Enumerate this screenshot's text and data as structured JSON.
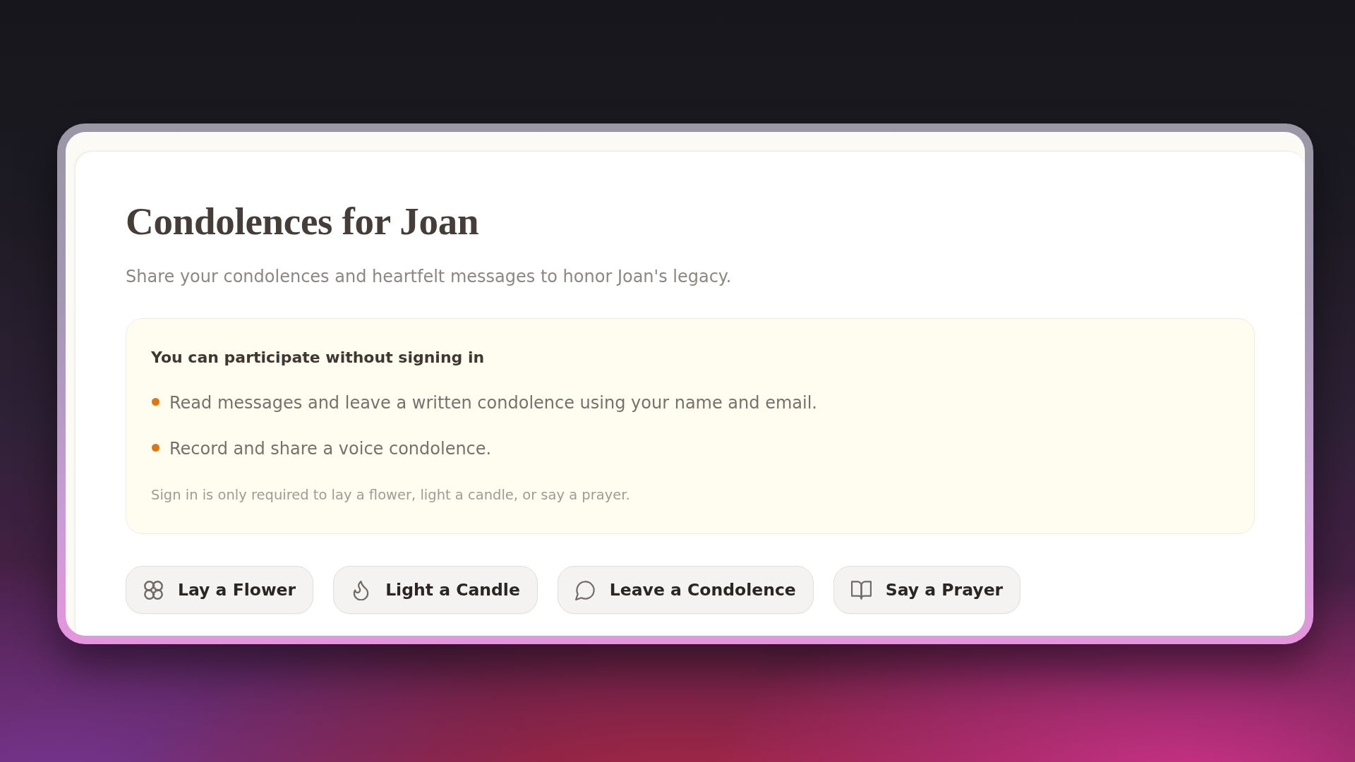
{
  "heading": "Condolences for Joan",
  "subtitle": "Share your condolences and heartfelt messages to honor Joan's legacy.",
  "info_box": {
    "title": "You can participate without signing in",
    "bullets": [
      "Read messages and leave a written condolence using your name and email.",
      "Record and share a voice condolence."
    ],
    "note": "Sign in is only required to lay a flower, light a candle, or say a prayer."
  },
  "actions": [
    {
      "label": "Lay a Flower"
    },
    {
      "label": "Light a Candle"
    },
    {
      "label": "Leave a Condolence"
    },
    {
      "label": "Say a Prayer"
    }
  ]
}
